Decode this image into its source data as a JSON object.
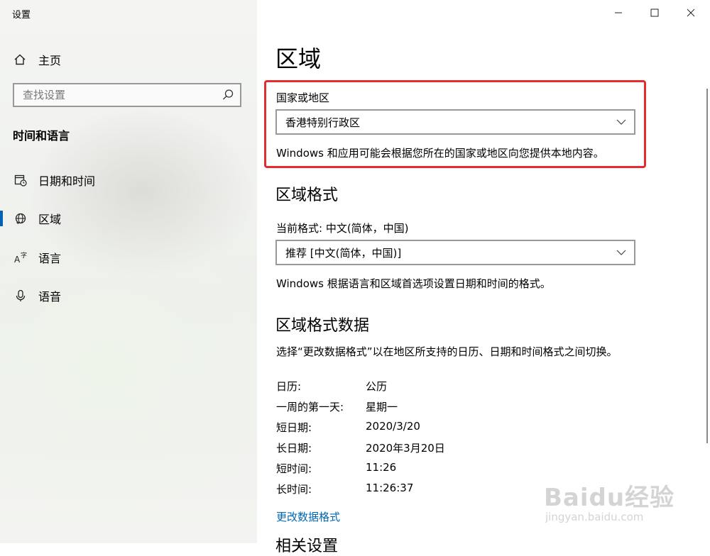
{
  "window": {
    "title": "设置",
    "buttons": {
      "minimize_icon": "minimize-icon",
      "maximize_icon": "maximize-icon",
      "close_icon": "close-icon"
    }
  },
  "sidebar": {
    "home_label": "主页",
    "search_placeholder": "查找设置",
    "section_title": "时间和语言",
    "items": [
      {
        "label": "日期和时间",
        "icon": "calendar-clock-icon"
      },
      {
        "label": "区域",
        "icon": "globe-icon",
        "active": true
      },
      {
        "label": "语言",
        "icon": "language-icon"
      },
      {
        "label": "语音",
        "icon": "microphone-icon"
      }
    ]
  },
  "main": {
    "page_title": "区域",
    "country_label": "国家或地区",
    "country_value": "香港特别行政区",
    "country_desc": "Windows 和应用可能会根据您所在的国家或地区向您提供本地内容。",
    "format_heading": "区域格式",
    "current_format_label": "当前格式: 中文(简体，中国)",
    "format_value": "推荐 [中文(简体，中国)]",
    "format_desc": "Windows 根据语言和区域首选项设置日期和时间的格式。",
    "data_heading": "区域格式数据",
    "data_desc": "选择“更改数据格式”以在地区所支持的日历、日期和时间格式之间切换。",
    "data_rows": [
      {
        "key": "日历:",
        "value": "公历"
      },
      {
        "key": "一周的第一天:",
        "value": "星期一"
      },
      {
        "key": "短日期:",
        "value": "2020/3/20"
      },
      {
        "key": "长日期:",
        "value": "2020年3月20日"
      },
      {
        "key": "短时间:",
        "value": "11:26"
      },
      {
        "key": "长时间:",
        "value": "11:26:37"
      }
    ],
    "change_link": "更改数据格式",
    "partial_heading": "相关设置"
  },
  "watermark": {
    "brand": "Baidu经验",
    "url": "jingyan.baidu.com"
  },
  "colors": {
    "accent": "#0063b1",
    "link": "#0066b4",
    "highlight": "#e42d2d"
  }
}
